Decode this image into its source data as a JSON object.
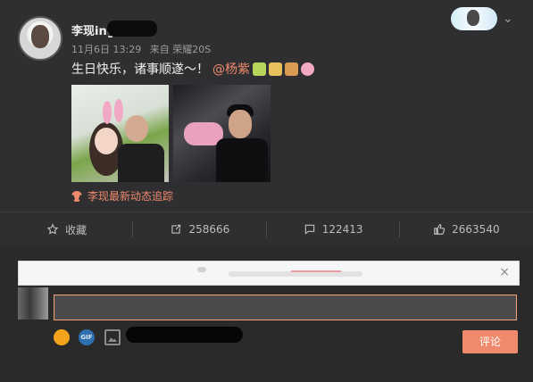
{
  "post": {
    "username": "李现ing",
    "time": "11月6日 13:29",
    "source": "来自 荣耀20S",
    "text": "生日快乐，诸事顺遂～！",
    "mention": "@杨紫",
    "track_link": "李现最新动态追踪"
  },
  "actions": [
    {
      "label": "收藏",
      "icon": "star-icon"
    },
    {
      "label": "258666",
      "icon": "repost-icon"
    },
    {
      "label": "122413",
      "icon": "comment-icon"
    },
    {
      "label": "2663540",
      "icon": "like-icon"
    }
  ],
  "comment": {
    "input_placeholder": "",
    "submit_label": "评论",
    "close_symbol": "×",
    "gif_label": "GIF"
  },
  "colors": {
    "accent": "#f08a6c",
    "background": "#2b2b2d"
  }
}
